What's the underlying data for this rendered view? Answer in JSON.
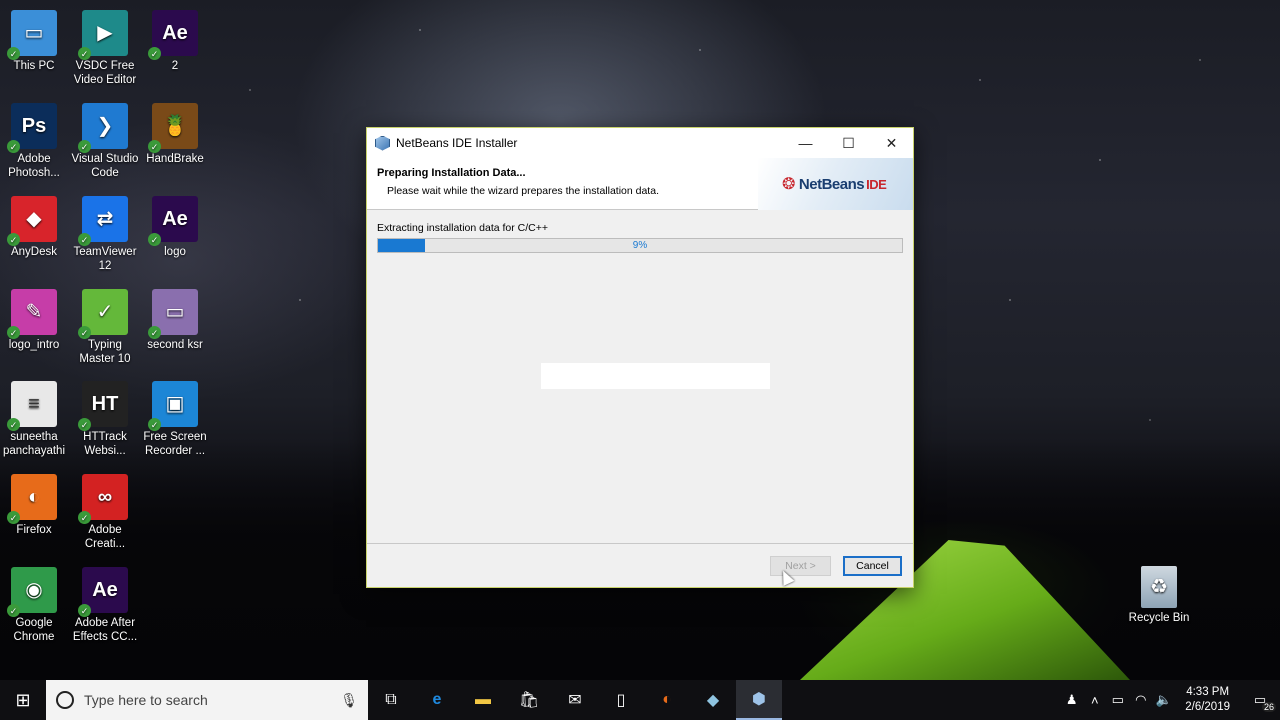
{
  "desktop": {
    "icons": [
      {
        "label": "This PC",
        "glyph": "▭",
        "color": "#3b8fd8"
      },
      {
        "label": "VSDC Free Video Editor",
        "glyph": "▶",
        "color": "#1e8a8a"
      },
      {
        "label": "2",
        "glyph": "Ae",
        "color": "#2b0a4d"
      },
      {
        "label": "Adobe Photosh...",
        "glyph": "Ps",
        "color": "#0b2d5a"
      },
      {
        "label": "Visual Studio Code",
        "glyph": "❯",
        "color": "#1f7ad1"
      },
      {
        "label": "HandBrake",
        "glyph": "🍍",
        "color": "#7a4a18"
      },
      {
        "label": "AnyDesk",
        "glyph": "◆",
        "color": "#d8242b"
      },
      {
        "label": "TeamViewer 12",
        "glyph": "⇄",
        "color": "#1a73e8"
      },
      {
        "label": "logo",
        "glyph": "Ae",
        "color": "#2b0a4d"
      },
      {
        "label": "logo_intro",
        "glyph": "✎",
        "color": "#c63da8"
      },
      {
        "label": "Typing Master 10",
        "glyph": "✓",
        "color": "#64b83a"
      },
      {
        "label": "second ksr",
        "glyph": "▭",
        "color": "#8a6fae"
      },
      {
        "label": "suneetha panchayathi",
        "glyph": "≡",
        "color": "#e8e8e8"
      },
      {
        "label": "HTTrack Websi...",
        "glyph": "HT",
        "color": "#222222"
      },
      {
        "label": "Free Screen Recorder ...",
        "glyph": "▣",
        "color": "#1c86d6"
      },
      {
        "label": "Firefox",
        "glyph": "◐",
        "color": "#e76b1a"
      },
      {
        "label": "Adobe Creati...",
        "glyph": "∞",
        "color": "#d32222"
      },
      {
        "label": "Google Chrome",
        "glyph": "◉",
        "color": "#2f9a4a"
      },
      {
        "label": "Adobe After Effects CC...",
        "glyph": "Ae",
        "color": "#2b0a4d"
      }
    ],
    "recycle_bin": "Recycle Bin"
  },
  "window": {
    "title": "NetBeans IDE Installer",
    "header_title": "Preparing Installation Data...",
    "header_subtitle": "Please wait while the wizard prepares the installation data.",
    "logo_text": "NetBeans",
    "logo_ide": "IDE",
    "progress_label": "Extracting installation data for C/C++",
    "progress_value": 0.09,
    "progress_text": "9%",
    "next_label": "Next >",
    "cancel_label": "Cancel",
    "minimize": "—",
    "maximize": "☐",
    "close": "✕"
  },
  "taskbar": {
    "search_placeholder": "Type here to search",
    "time": "4:33 PM",
    "date": "2/6/2019",
    "notification_count": "26"
  },
  "colors": {
    "accent": "#1979d2",
    "tent": "#8fd42f"
  }
}
